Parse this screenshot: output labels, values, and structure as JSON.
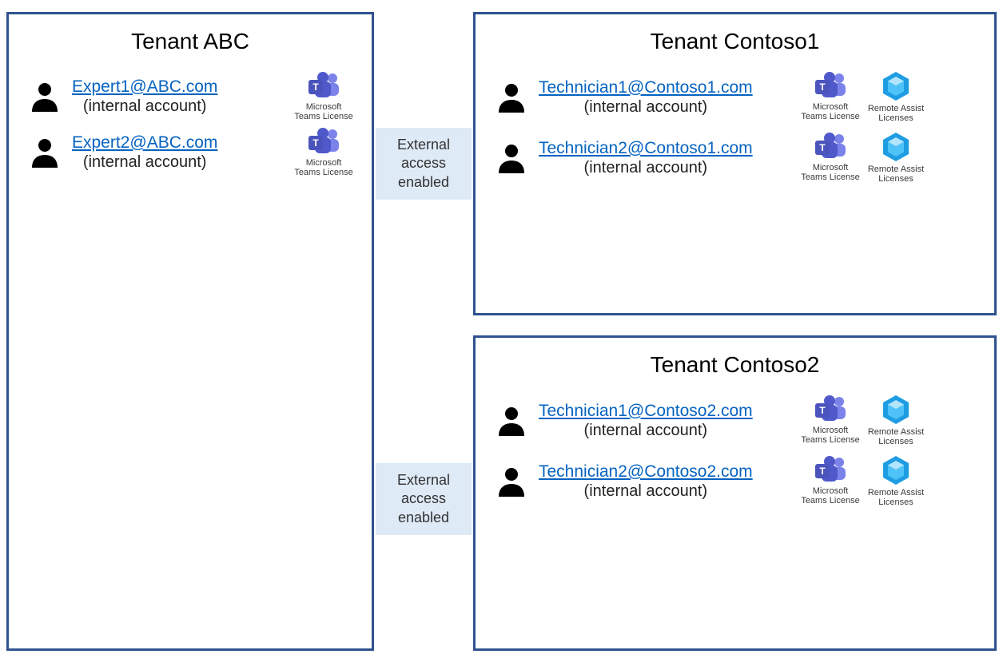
{
  "connector_label": "External access enabled",
  "teams_license_label": "Microsoft Teams License",
  "remote_assist_label": "Remote Assist Licenses",
  "internal_label": "(internal account)",
  "tenants": {
    "abc": {
      "title": "Tenant ABC",
      "users": [
        {
          "email": "Expert1@ABC.com"
        },
        {
          "email": "Expert2@ABC.com"
        }
      ]
    },
    "contoso1": {
      "title": "Tenant Contoso1",
      "users": [
        {
          "email": "Technician1@Contoso1.com"
        },
        {
          "email": "Technician2@Contoso1.com"
        }
      ]
    },
    "contoso2": {
      "title": "Tenant Contoso2",
      "users": [
        {
          "email": "Technician1@Contoso2.com"
        },
        {
          "email": "Technician2@Contoso2.com"
        }
      ]
    }
  }
}
